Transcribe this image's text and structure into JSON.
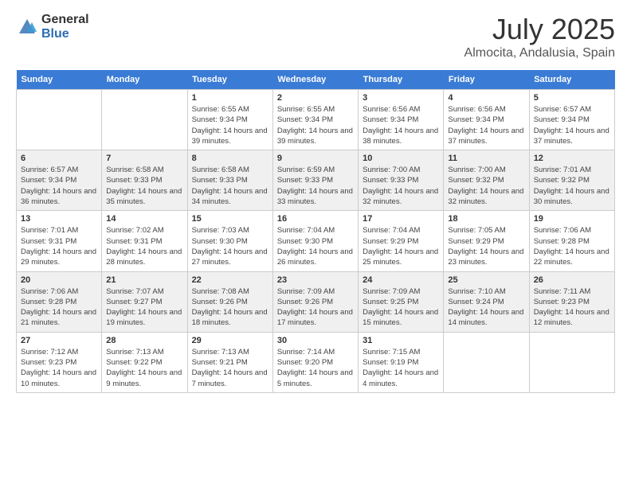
{
  "header": {
    "logo_general": "General",
    "logo_blue": "Blue",
    "month_title": "July 2025",
    "location": "Almocita, Andalusia, Spain"
  },
  "weekdays": [
    "Sunday",
    "Monday",
    "Tuesday",
    "Wednesday",
    "Thursday",
    "Friday",
    "Saturday"
  ],
  "weeks": [
    [
      {
        "day": "",
        "info": ""
      },
      {
        "day": "",
        "info": ""
      },
      {
        "day": "1",
        "info": "Sunrise: 6:55 AM\nSunset: 9:34 PM\nDaylight: 14 hours and 39 minutes."
      },
      {
        "day": "2",
        "info": "Sunrise: 6:55 AM\nSunset: 9:34 PM\nDaylight: 14 hours and 39 minutes."
      },
      {
        "day": "3",
        "info": "Sunrise: 6:56 AM\nSunset: 9:34 PM\nDaylight: 14 hours and 38 minutes."
      },
      {
        "day": "4",
        "info": "Sunrise: 6:56 AM\nSunset: 9:34 PM\nDaylight: 14 hours and 37 minutes."
      },
      {
        "day": "5",
        "info": "Sunrise: 6:57 AM\nSunset: 9:34 PM\nDaylight: 14 hours and 37 minutes."
      }
    ],
    [
      {
        "day": "6",
        "info": "Sunrise: 6:57 AM\nSunset: 9:34 PM\nDaylight: 14 hours and 36 minutes."
      },
      {
        "day": "7",
        "info": "Sunrise: 6:58 AM\nSunset: 9:33 PM\nDaylight: 14 hours and 35 minutes."
      },
      {
        "day": "8",
        "info": "Sunrise: 6:58 AM\nSunset: 9:33 PM\nDaylight: 14 hours and 34 minutes."
      },
      {
        "day": "9",
        "info": "Sunrise: 6:59 AM\nSunset: 9:33 PM\nDaylight: 14 hours and 33 minutes."
      },
      {
        "day": "10",
        "info": "Sunrise: 7:00 AM\nSunset: 9:33 PM\nDaylight: 14 hours and 32 minutes."
      },
      {
        "day": "11",
        "info": "Sunrise: 7:00 AM\nSunset: 9:32 PM\nDaylight: 14 hours and 32 minutes."
      },
      {
        "day": "12",
        "info": "Sunrise: 7:01 AM\nSunset: 9:32 PM\nDaylight: 14 hours and 30 minutes."
      }
    ],
    [
      {
        "day": "13",
        "info": "Sunrise: 7:01 AM\nSunset: 9:31 PM\nDaylight: 14 hours and 29 minutes."
      },
      {
        "day": "14",
        "info": "Sunrise: 7:02 AM\nSunset: 9:31 PM\nDaylight: 14 hours and 28 minutes."
      },
      {
        "day": "15",
        "info": "Sunrise: 7:03 AM\nSunset: 9:30 PM\nDaylight: 14 hours and 27 minutes."
      },
      {
        "day": "16",
        "info": "Sunrise: 7:04 AM\nSunset: 9:30 PM\nDaylight: 14 hours and 26 minutes."
      },
      {
        "day": "17",
        "info": "Sunrise: 7:04 AM\nSunset: 9:29 PM\nDaylight: 14 hours and 25 minutes."
      },
      {
        "day": "18",
        "info": "Sunrise: 7:05 AM\nSunset: 9:29 PM\nDaylight: 14 hours and 23 minutes."
      },
      {
        "day": "19",
        "info": "Sunrise: 7:06 AM\nSunset: 9:28 PM\nDaylight: 14 hours and 22 minutes."
      }
    ],
    [
      {
        "day": "20",
        "info": "Sunrise: 7:06 AM\nSunset: 9:28 PM\nDaylight: 14 hours and 21 minutes."
      },
      {
        "day": "21",
        "info": "Sunrise: 7:07 AM\nSunset: 9:27 PM\nDaylight: 14 hours and 19 minutes."
      },
      {
        "day": "22",
        "info": "Sunrise: 7:08 AM\nSunset: 9:26 PM\nDaylight: 14 hours and 18 minutes."
      },
      {
        "day": "23",
        "info": "Sunrise: 7:09 AM\nSunset: 9:26 PM\nDaylight: 14 hours and 17 minutes."
      },
      {
        "day": "24",
        "info": "Sunrise: 7:09 AM\nSunset: 9:25 PM\nDaylight: 14 hours and 15 minutes."
      },
      {
        "day": "25",
        "info": "Sunrise: 7:10 AM\nSunset: 9:24 PM\nDaylight: 14 hours and 14 minutes."
      },
      {
        "day": "26",
        "info": "Sunrise: 7:11 AM\nSunset: 9:23 PM\nDaylight: 14 hours and 12 minutes."
      }
    ],
    [
      {
        "day": "27",
        "info": "Sunrise: 7:12 AM\nSunset: 9:23 PM\nDaylight: 14 hours and 10 minutes."
      },
      {
        "day": "28",
        "info": "Sunrise: 7:13 AM\nSunset: 9:22 PM\nDaylight: 14 hours and 9 minutes."
      },
      {
        "day": "29",
        "info": "Sunrise: 7:13 AM\nSunset: 9:21 PM\nDaylight: 14 hours and 7 minutes."
      },
      {
        "day": "30",
        "info": "Sunrise: 7:14 AM\nSunset: 9:20 PM\nDaylight: 14 hours and 5 minutes."
      },
      {
        "day": "31",
        "info": "Sunrise: 7:15 AM\nSunset: 9:19 PM\nDaylight: 14 hours and 4 minutes."
      },
      {
        "day": "",
        "info": ""
      },
      {
        "day": "",
        "info": ""
      }
    ]
  ]
}
